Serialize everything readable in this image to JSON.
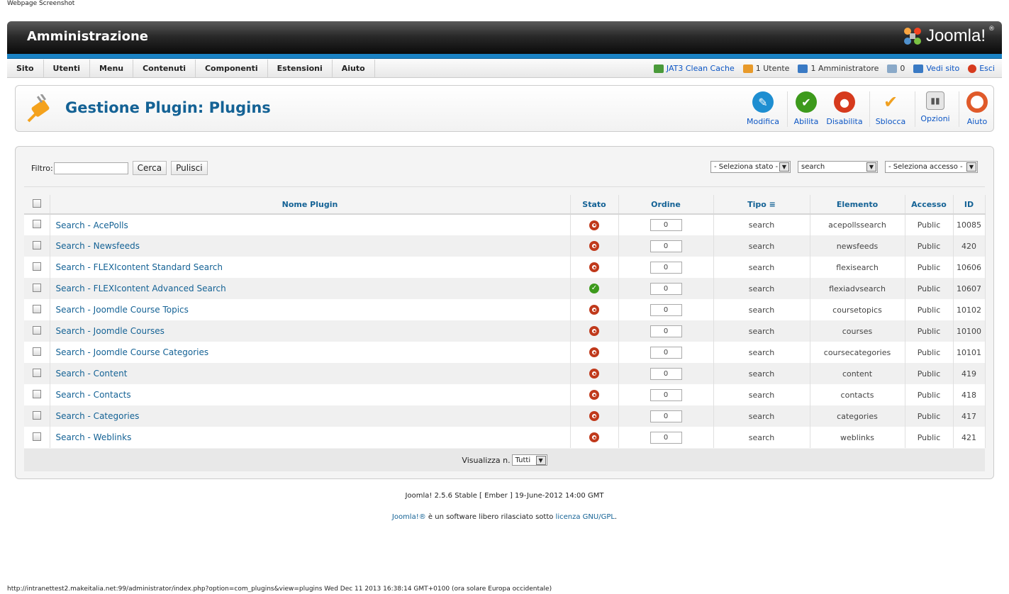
{
  "caption": "Webpage Screenshot",
  "header": {
    "title": "Amministrazione",
    "logo_text": "Joomla!",
    "logo_tm": "®"
  },
  "menu": [
    "Sito",
    "Utenti",
    "Menu",
    "Contenuti",
    "Componenti",
    "Estensioni",
    "Aiuto"
  ],
  "status": {
    "cache": "JAT3 Clean Cache",
    "users": "1 Utente",
    "admins": "1 Amministratore",
    "messages": "0",
    "view_site": "Vedi sito",
    "logout": "Esci"
  },
  "page_title": "Gestione Plugin: Plugins",
  "toolbar": [
    {
      "label": "Modifica",
      "icon": "pencil-icon",
      "color": "#1e8ed1"
    },
    {
      "label": "Abilita",
      "icon": "check-icon",
      "color": "#3d9a1c"
    },
    {
      "label": "Disabilita",
      "icon": "disable-icon",
      "color": "#d63a1d"
    },
    {
      "label": "Sblocca",
      "icon": "unlock-check-icon",
      "color": "#f0a020"
    },
    {
      "label": "Opzioni",
      "icon": "options-icon",
      "color": "#999999"
    },
    {
      "label": "Aiuto",
      "icon": "lifebuoy-icon",
      "color": "#e05a2a"
    }
  ],
  "filter": {
    "label": "Filtro:",
    "value": "",
    "search_btn": "Cerca",
    "clear_btn": "Pulisci"
  },
  "selects": {
    "state": "- Seleziona stato -",
    "folder": "search",
    "access": "- Seleziona accesso -"
  },
  "columns": {
    "name": "Nome Plugin",
    "state": "Stato",
    "order": "Ordine",
    "type": "Tipo",
    "element": "Elemento",
    "access": "Accesso",
    "id": "ID"
  },
  "rows": [
    {
      "name": "Search - AcePolls",
      "enabled": false,
      "order": "0",
      "type": "search",
      "element": "acepollssearch",
      "access": "Public",
      "id": "10085"
    },
    {
      "name": "Search - Newsfeeds",
      "enabled": false,
      "order": "0",
      "type": "search",
      "element": "newsfeeds",
      "access": "Public",
      "id": "420"
    },
    {
      "name": "Search - FLEXIcontent Standard Search",
      "enabled": false,
      "order": "0",
      "type": "search",
      "element": "flexisearch",
      "access": "Public",
      "id": "10606"
    },
    {
      "name": "Search - FLEXIcontent Advanced Search",
      "enabled": true,
      "order": "0",
      "type": "search",
      "element": "flexiadvsearch",
      "access": "Public",
      "id": "10607"
    },
    {
      "name": "Search - Joomdle Course Topics",
      "enabled": false,
      "order": "0",
      "type": "search",
      "element": "coursetopics",
      "access": "Public",
      "id": "10102"
    },
    {
      "name": "Search - Joomdle Courses",
      "enabled": false,
      "order": "0",
      "type": "search",
      "element": "courses",
      "access": "Public",
      "id": "10100"
    },
    {
      "name": "Search - Joomdle Course Categories",
      "enabled": false,
      "order": "0",
      "type": "search",
      "element": "coursecategories",
      "access": "Public",
      "id": "10101"
    },
    {
      "name": "Search - Content",
      "enabled": false,
      "order": "0",
      "type": "search",
      "element": "content",
      "access": "Public",
      "id": "419"
    },
    {
      "name": "Search - Contacts",
      "enabled": false,
      "order": "0",
      "type": "search",
      "element": "contacts",
      "access": "Public",
      "id": "418"
    },
    {
      "name": "Search - Categories",
      "enabled": false,
      "order": "0",
      "type": "search",
      "element": "categories",
      "access": "Public",
      "id": "417"
    },
    {
      "name": "Search - Weblinks",
      "enabled": false,
      "order": "0",
      "type": "search",
      "element": "weblinks",
      "access": "Public",
      "id": "421"
    }
  ],
  "pagination": {
    "label": "Visualizza n.",
    "value": "Tutti"
  },
  "footer": {
    "version": "Joomla! 2.5.6 Stable [ Ember ] 19-June-2012 14:00 GMT",
    "joomla_link": "Joomla!®",
    "license_text": " è un software libero rilasciato sotto ",
    "license_link": "licenza GNU/GPL",
    "end": "."
  },
  "url_line": "http://intranettest2.makeitalia.net:99/administrator/index.php?option=com_plugins&view=plugins Wed Dec 11 2013 16:38:14 GMT+0100 (ora solare Europa occidentale)"
}
